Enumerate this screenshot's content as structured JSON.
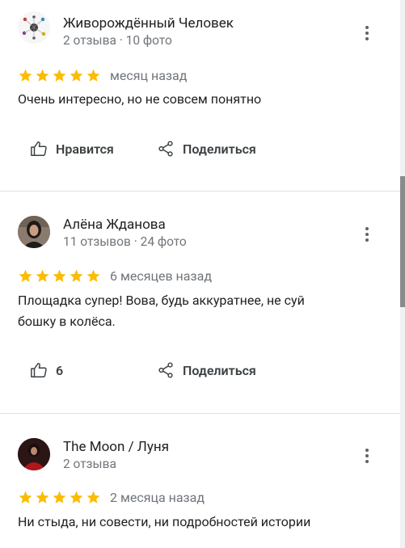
{
  "reviews": [
    {
      "author": "Живорождённый Человек",
      "meta": "2 отзыва · 10 фото",
      "rating": 5,
      "date": "месяц назад",
      "text": "Очень интересно, но не совсем понятно",
      "like_label": "Нравится",
      "share_label": "Поделиться"
    },
    {
      "author": "Алёна Жданова",
      "meta": "11 отзывов · 24 фото",
      "rating": 5,
      "date": "6 месяцев назад",
      "text": "Площадка супер! Вова, будь аккуратнее, не суй бошку в колёса.",
      "like_label": "6",
      "share_label": "Поделиться"
    },
    {
      "author": "The Moon / Луня",
      "meta": "2 отзыва",
      "rating": 5,
      "date": "2 месяца назад",
      "text": "Ни стыда, ни совести, ни подробностей истории"
    }
  ],
  "colors": {
    "star": "#fbbc04",
    "secondary_text": "#70757a",
    "primary_text": "#202124",
    "divider": "#e0e0e0"
  },
  "scrollbar": {
    "position": 0.32,
    "visible_fraction": 0.24
  }
}
